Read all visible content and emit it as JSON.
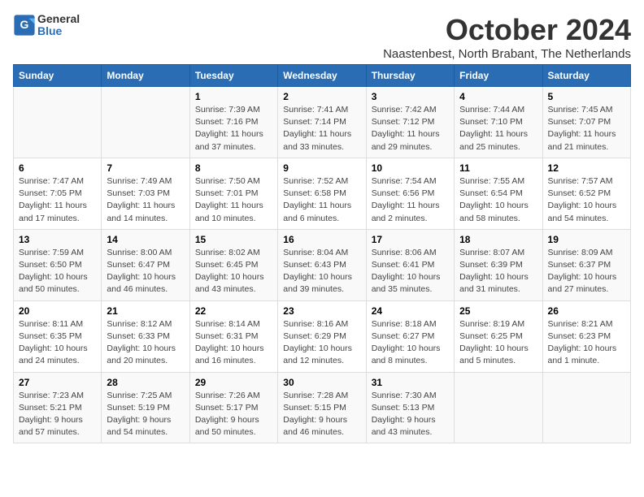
{
  "header": {
    "logo": {
      "general": "General",
      "blue": "Blue"
    },
    "title": "October 2024",
    "subtitle": "Naastenbest, North Brabant, The Netherlands"
  },
  "calendar": {
    "weekdays": [
      "Sunday",
      "Monday",
      "Tuesday",
      "Wednesday",
      "Thursday",
      "Friday",
      "Saturday"
    ],
    "weeks": [
      [
        {
          "day": "",
          "info": ""
        },
        {
          "day": "",
          "info": ""
        },
        {
          "day": "1",
          "info": "Sunrise: 7:39 AM\nSunset: 7:16 PM\nDaylight: 11 hours and 37 minutes."
        },
        {
          "day": "2",
          "info": "Sunrise: 7:41 AM\nSunset: 7:14 PM\nDaylight: 11 hours and 33 minutes."
        },
        {
          "day": "3",
          "info": "Sunrise: 7:42 AM\nSunset: 7:12 PM\nDaylight: 11 hours and 29 minutes."
        },
        {
          "day": "4",
          "info": "Sunrise: 7:44 AM\nSunset: 7:10 PM\nDaylight: 11 hours and 25 minutes."
        },
        {
          "day": "5",
          "info": "Sunrise: 7:45 AM\nSunset: 7:07 PM\nDaylight: 11 hours and 21 minutes."
        }
      ],
      [
        {
          "day": "6",
          "info": "Sunrise: 7:47 AM\nSunset: 7:05 PM\nDaylight: 11 hours and 17 minutes."
        },
        {
          "day": "7",
          "info": "Sunrise: 7:49 AM\nSunset: 7:03 PM\nDaylight: 11 hours and 14 minutes."
        },
        {
          "day": "8",
          "info": "Sunrise: 7:50 AM\nSunset: 7:01 PM\nDaylight: 11 hours and 10 minutes."
        },
        {
          "day": "9",
          "info": "Sunrise: 7:52 AM\nSunset: 6:58 PM\nDaylight: 11 hours and 6 minutes."
        },
        {
          "day": "10",
          "info": "Sunrise: 7:54 AM\nSunset: 6:56 PM\nDaylight: 11 hours and 2 minutes."
        },
        {
          "day": "11",
          "info": "Sunrise: 7:55 AM\nSunset: 6:54 PM\nDaylight: 10 hours and 58 minutes."
        },
        {
          "day": "12",
          "info": "Sunrise: 7:57 AM\nSunset: 6:52 PM\nDaylight: 10 hours and 54 minutes."
        }
      ],
      [
        {
          "day": "13",
          "info": "Sunrise: 7:59 AM\nSunset: 6:50 PM\nDaylight: 10 hours and 50 minutes."
        },
        {
          "day": "14",
          "info": "Sunrise: 8:00 AM\nSunset: 6:47 PM\nDaylight: 10 hours and 46 minutes."
        },
        {
          "day": "15",
          "info": "Sunrise: 8:02 AM\nSunset: 6:45 PM\nDaylight: 10 hours and 43 minutes."
        },
        {
          "day": "16",
          "info": "Sunrise: 8:04 AM\nSunset: 6:43 PM\nDaylight: 10 hours and 39 minutes."
        },
        {
          "day": "17",
          "info": "Sunrise: 8:06 AM\nSunset: 6:41 PM\nDaylight: 10 hours and 35 minutes."
        },
        {
          "day": "18",
          "info": "Sunrise: 8:07 AM\nSunset: 6:39 PM\nDaylight: 10 hours and 31 minutes."
        },
        {
          "day": "19",
          "info": "Sunrise: 8:09 AM\nSunset: 6:37 PM\nDaylight: 10 hours and 27 minutes."
        }
      ],
      [
        {
          "day": "20",
          "info": "Sunrise: 8:11 AM\nSunset: 6:35 PM\nDaylight: 10 hours and 24 minutes."
        },
        {
          "day": "21",
          "info": "Sunrise: 8:12 AM\nSunset: 6:33 PM\nDaylight: 10 hours and 20 minutes."
        },
        {
          "day": "22",
          "info": "Sunrise: 8:14 AM\nSunset: 6:31 PM\nDaylight: 10 hours and 16 minutes."
        },
        {
          "day": "23",
          "info": "Sunrise: 8:16 AM\nSunset: 6:29 PM\nDaylight: 10 hours and 12 minutes."
        },
        {
          "day": "24",
          "info": "Sunrise: 8:18 AM\nSunset: 6:27 PM\nDaylight: 10 hours and 8 minutes."
        },
        {
          "day": "25",
          "info": "Sunrise: 8:19 AM\nSunset: 6:25 PM\nDaylight: 10 hours and 5 minutes."
        },
        {
          "day": "26",
          "info": "Sunrise: 8:21 AM\nSunset: 6:23 PM\nDaylight: 10 hours and 1 minute."
        }
      ],
      [
        {
          "day": "27",
          "info": "Sunrise: 7:23 AM\nSunset: 5:21 PM\nDaylight: 9 hours and 57 minutes."
        },
        {
          "day": "28",
          "info": "Sunrise: 7:25 AM\nSunset: 5:19 PM\nDaylight: 9 hours and 54 minutes."
        },
        {
          "day": "29",
          "info": "Sunrise: 7:26 AM\nSunset: 5:17 PM\nDaylight: 9 hours and 50 minutes."
        },
        {
          "day": "30",
          "info": "Sunrise: 7:28 AM\nSunset: 5:15 PM\nDaylight: 9 hours and 46 minutes."
        },
        {
          "day": "31",
          "info": "Sunrise: 7:30 AM\nSunset: 5:13 PM\nDaylight: 9 hours and 43 minutes."
        },
        {
          "day": "",
          "info": ""
        },
        {
          "day": "",
          "info": ""
        }
      ]
    ]
  }
}
